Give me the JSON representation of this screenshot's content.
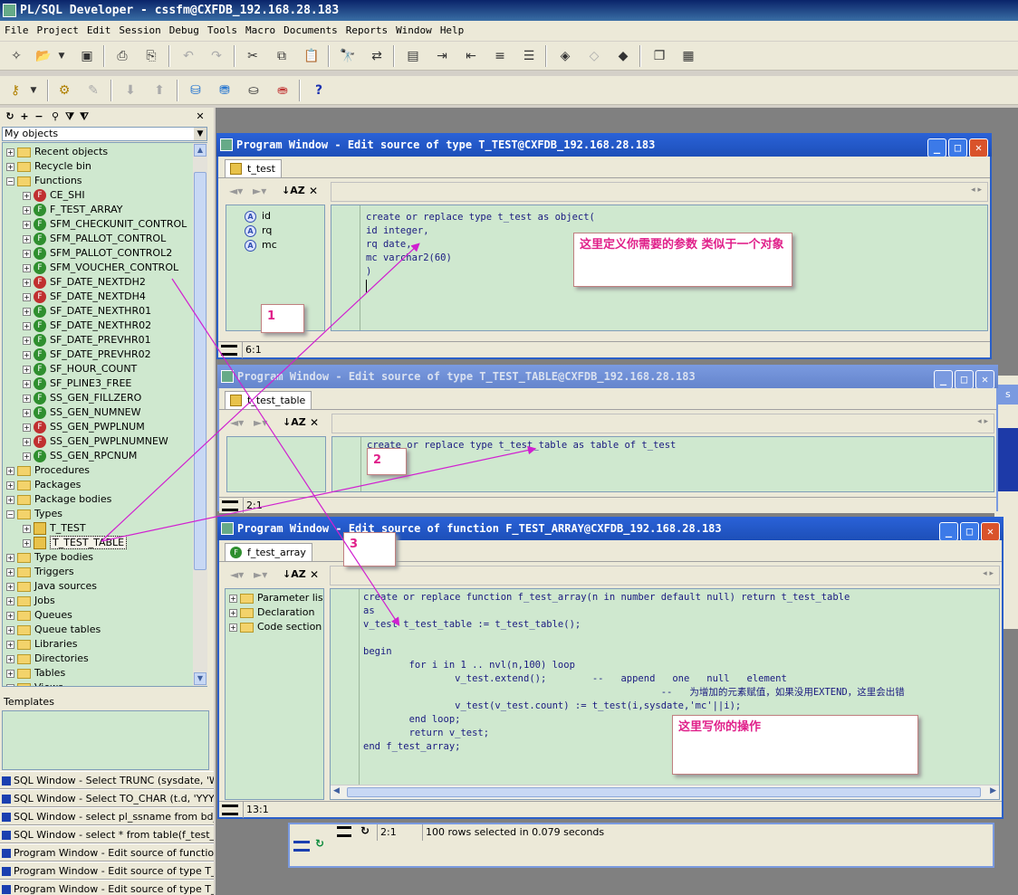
{
  "app": {
    "title": "PL/SQL Developer - cssfm@CXFDB_192.168.28.183"
  },
  "menu": [
    "File",
    "Project",
    "Edit",
    "Session",
    "Debug",
    "Tools",
    "Macro",
    "Documents",
    "Reports",
    "Window",
    "Help"
  ],
  "icons": {
    "toolbar1": [
      "new-icon",
      "open-icon",
      "dropdown-icon",
      "save-icon",
      "print-icon",
      "print-preview-icon",
      "undo-icon",
      "redo-icon",
      "cut-icon",
      "copy-icon",
      "paste-icon",
      "find-icon",
      "replace-icon",
      "execute-script-icon",
      "indent-icon",
      "unindent-icon",
      "comment-icon",
      "uncomment-icon",
      "debug-icon",
      "step-icon",
      "compile-icon",
      "cascade-windows-icon",
      "tile-windows-icon"
    ],
    "toolbar2": [
      "key-icon",
      "dropdown-icon",
      "gear-icon",
      "break-icon",
      "commit-icon",
      "rollback-icon",
      "sql-window-icon",
      "new-sql-icon",
      "command-window-icon",
      "explain-plan-icon",
      "help-icon"
    ]
  },
  "object_browser": {
    "selector": "My objects",
    "templates_label": "Templates",
    "tree": [
      {
        "label": "Recent objects",
        "kind": "folder",
        "expanded": false
      },
      {
        "label": "Recycle bin",
        "kind": "folder",
        "expanded": false
      },
      {
        "label": "Functions",
        "kind": "folder",
        "expanded": true
      },
      {
        "label": "CE_SHI",
        "kind": "function-invalid"
      },
      {
        "label": "F_TEST_ARRAY",
        "kind": "function"
      },
      {
        "label": "SFM_CHECKUNIT_CONTROL",
        "kind": "function"
      },
      {
        "label": "SFM_PALLOT_CONTROL",
        "kind": "function"
      },
      {
        "label": "SFM_PALLOT_CONTROL2",
        "kind": "function"
      },
      {
        "label": "SFM_VOUCHER_CONTROL",
        "kind": "function"
      },
      {
        "label": "SF_DATE_NEXTDH2",
        "kind": "function-invalid"
      },
      {
        "label": "SF_DATE_NEXTDH4",
        "kind": "function-invalid"
      },
      {
        "label": "SF_DATE_NEXTHR01",
        "kind": "function"
      },
      {
        "label": "SF_DATE_NEXTHR02",
        "kind": "function"
      },
      {
        "label": "SF_DATE_PREVHR01",
        "kind": "function"
      },
      {
        "label": "SF_DATE_PREVHR02",
        "kind": "function"
      },
      {
        "label": "SF_HOUR_COUNT",
        "kind": "function"
      },
      {
        "label": "SF_PLINE3_FREE",
        "kind": "function"
      },
      {
        "label": "SS_GEN_FILLZERO",
        "kind": "function"
      },
      {
        "label": "SS_GEN_NUMNEW",
        "kind": "function"
      },
      {
        "label": "SS_GEN_PWPLNUM",
        "kind": "function-invalid"
      },
      {
        "label": "SS_GEN_PWPLNUMNEW",
        "kind": "function-invalid"
      },
      {
        "label": "SS_GEN_RPCNUM",
        "kind": "function"
      },
      {
        "label": "Procedures",
        "kind": "folder",
        "expanded": false
      },
      {
        "label": "Packages",
        "kind": "folder",
        "expanded": false
      },
      {
        "label": "Package bodies",
        "kind": "folder",
        "expanded": false
      },
      {
        "label": "Types",
        "kind": "folder",
        "expanded": true
      },
      {
        "label": "T_TEST",
        "kind": "type"
      },
      {
        "label": "T_TEST_TABLE",
        "kind": "type",
        "selected": true
      },
      {
        "label": "Type bodies",
        "kind": "folder",
        "expanded": false
      },
      {
        "label": "Triggers",
        "kind": "folder",
        "expanded": false
      },
      {
        "label": "Java sources",
        "kind": "folder",
        "expanded": false
      },
      {
        "label": "Jobs",
        "kind": "folder",
        "expanded": false
      },
      {
        "label": "Queues",
        "kind": "folder",
        "expanded": false
      },
      {
        "label": "Queue tables",
        "kind": "folder",
        "expanded": false
      },
      {
        "label": "Libraries",
        "kind": "folder",
        "expanded": false
      },
      {
        "label": "Directories",
        "kind": "folder",
        "expanded": false
      },
      {
        "label": "Tables",
        "kind": "folder",
        "expanded": false
      },
      {
        "label": "Views",
        "kind": "folder",
        "expanded": false
      }
    ]
  },
  "window_list": [
    "SQL Window - Select TRUNC (sysdate, 'WW",
    "SQL Window - Select TO_CHAR (t.d, 'YYYY-",
    "SQL Window - select pl_ssname from bd_plin",
    "SQL Window - select * from table(f_test_array",
    "Program Window - Edit source of function F_T",
    "Program Window - Edit source of type T_TES",
    "Program Window - Edit source of type T_TES"
  ],
  "windows": [
    {
      "title": "Program Window - Edit source of type T_TEST@CXFDB_192.168.28.183",
      "tab": "t_test",
      "attributes": [
        "id",
        "rq",
        "mc"
      ],
      "code": "create or replace type t_test as object(\nid integer,\nrq date,\nmc varchar2(60)\n)",
      "cursor": "6:1",
      "note": "这里定义你需要的参数 类似于一个对象",
      "marker": "1"
    },
    {
      "title": "Program Window - Edit source of type T_TEST_TABLE@CXFDB_192.168.28.183",
      "tab": "t_test_table",
      "code": "create or replace type t_test_table as table of t_test",
      "cursor": "2:1",
      "marker": "2"
    },
    {
      "title": "Program Window - Edit source of function F_TEST_ARRAY@CXFDB_192.168.28.183",
      "tab": "f_test_array",
      "sections": [
        "Parameter list",
        "Declaration",
        "Code section"
      ],
      "code": "create or replace function f_test_array(n in number default null) return t_test_table\nas\nv_test t_test_table := t_test_table();\n\nbegin\n        for i in 1 .. nvl(n,100) loop\n                v_test.extend();        --   append   one   null   element\n                                                    --   为增加的元素赋值，如果没用EXTEND，这里会出错\n                v_test(v_test.count) := t_test(i,sysdate,'mc'||i);\n        end loop;\n        return v_test;\nend f_test_array;",
      "cursor": "13:1",
      "note": "这里写你的操作",
      "marker": "3"
    }
  ],
  "background_sql": {
    "cursor": "2:1",
    "message": "100 rows selected in 0.079 seconds",
    "partial_text": "s"
  },
  "colors": {
    "editor_bg": "#cfe8cf",
    "title_active": "#2a62d8",
    "note_text": "#e0208a",
    "arrow": "#d020d0"
  }
}
